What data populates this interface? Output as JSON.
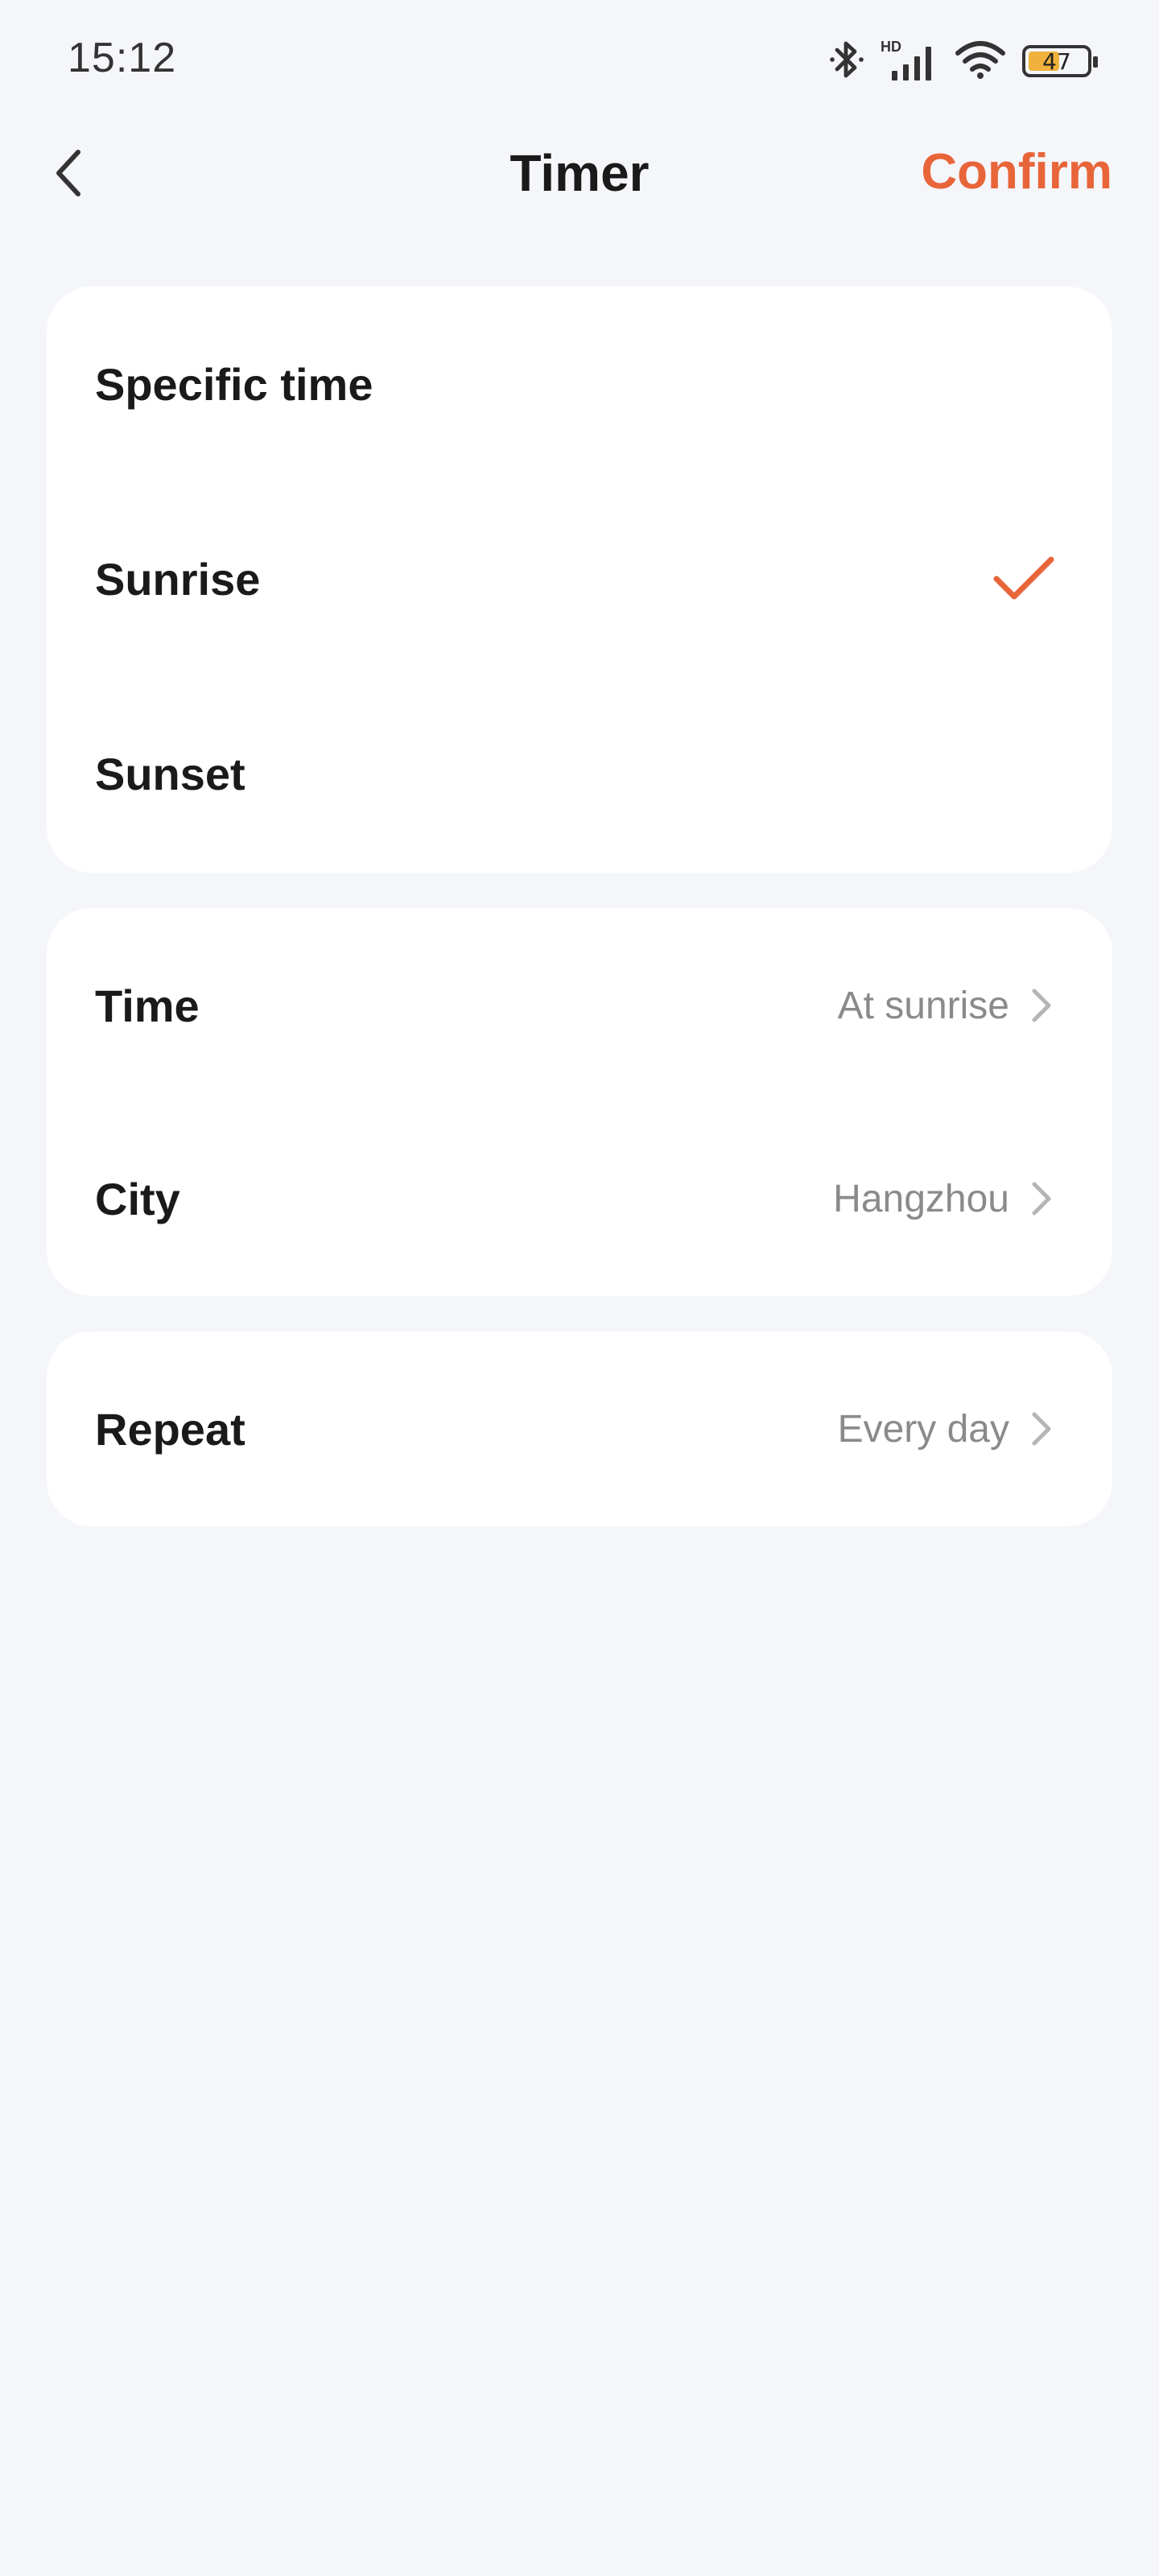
{
  "status_bar": {
    "time": "15:12",
    "hd_label": "HD",
    "battery_level": "47"
  },
  "nav": {
    "title": "Timer",
    "confirm_label": "Confirm"
  },
  "trigger_options": [
    {
      "label": "Specific time",
      "selected": false
    },
    {
      "label": "Sunrise",
      "selected": true
    },
    {
      "label": "Sunset",
      "selected": false
    }
  ],
  "settings": {
    "time": {
      "label": "Time",
      "value": "At sunrise"
    },
    "city": {
      "label": "City",
      "value": "Hangzhou"
    },
    "repeat": {
      "label": "Repeat",
      "value": "Every day"
    }
  },
  "colors": {
    "accent": "#e8653a",
    "background": "#f5f6fa",
    "card": "#ffffff",
    "secondary_text": "#8a8a8a"
  }
}
